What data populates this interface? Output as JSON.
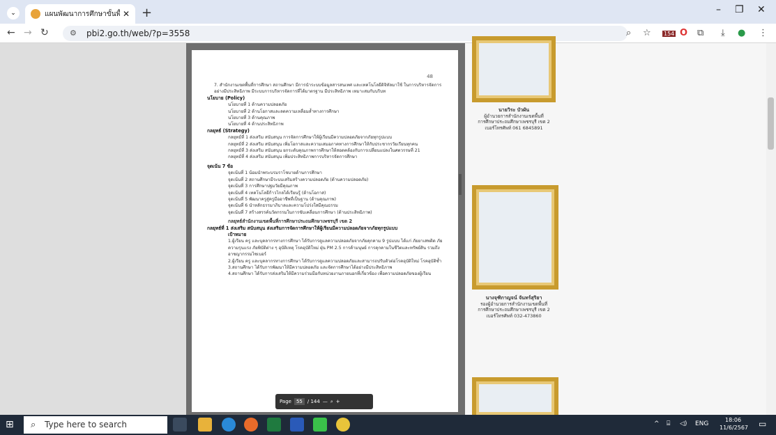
{
  "tab": {
    "title": "แผนพัฒนาการศึกษาขั้นพื้นฐาน ระยะ"
  },
  "address": {
    "url": "pbi2.go.th/web/?p=3558"
  },
  "document": {
    "page_number": "48",
    "intro_line": "7. สำนักงานเขตพื้นที่การศึกษา สถานศึกษา มีการนำระบบข้อมูลสารสนเทศ และเทคโนโลยีดิจิทัลมาใช้ ในการบริหารจัดการอย่างมีประสิทธิภาพ มีระบบการบริหารจัดการที่ได้มาตรฐาน มีประสิทธิภาพ เหมาะสมกับบริบท",
    "policy_head": "นโยบาย (Policy)",
    "policies": [
      "นโยบายที่ 1 ด้านความปลอดภัย",
      "นโยบายที่ 2 ด้านโอกาสและลดความเหลื่อมล้ำทางการศึกษา",
      "นโยบายที่ 3 ด้านคุณภาพ",
      "นโยบายที่ 4 ด้านประสิทธิภาพ"
    ],
    "strategy_head": "กลยุทธ์ (Strategy)",
    "strategies": [
      "กลยุทธ์ที่ 1 ส่งเสริม สนับสนุน การจัดการศึกษาให้ผู้เรียนมีความปลอดภัยจากภัยทุกรูปแบบ",
      "กลยุทธ์ที่ 2 ส่งเสริม สนับสนุน เพิ่มโอกาสและความเสมอภาคทางการศึกษาให้กับประชากรวัยเรียนทุกคน",
      "กลยุทธ์ที่ 3 ส่งเสริม สนับสนุน ยกระดับคุณภาพการศึกษาให้สอดคล้องกับการเปลี่ยนแปลงในศตวรรษที่ 21",
      "กลยุทธ์ที่ 4 ส่งเสริม สนับสนุน เพิ่มประสิทธิภาพการบริหารจัดการศึกษา"
    ],
    "focus_head": "จุดเน้น 7 ข้อ",
    "focus": [
      "จุดเน้นที่ 1 น้อมนำพระบรมราโชบายด้านการศึกษา",
      "จุดเน้นที่ 2 สถานศึกษามีระบบเสริมสร้างความปลอดภัย (ด้านความปลอดภัย)",
      "จุดเน้นที่ 3 การศึกษาปฐมวัยมีคุณภาพ",
      "จุดเน้นที่ 4 เทคโนโลยีก้าวไกลได้เรียนรู้ (ด้านโอกาส)",
      "จุดเน้นที่ 5 พัฒนาครูสู่ครูมืออาชีพที่เป็นฐาน (ด้านคุณภาพ)",
      "จุดเน้นที่ 6 นำหลักธรรมาภิบาลและความโปร่งใสมีคุณธรรม",
      "จุดเน้นที่ 7 สร้างสรรค์นวัตกรรมในการขับเคลื่อนการศึกษา (ด้านประสิทธิภาพ)"
    ],
    "section_title": "กลยุทธ์สำนักงานเขตพื้นที่การศึกษาประถมศึกษาเพชรบุรี เขต 2",
    "strategy1_title": "กลยุทธ์ที่ 1 ส่งเสริม สนับสนุน ส่งเสริมการจัดการศึกษาให้ผู้เรียนมีความปลอดภัยจากภัยทุกรูปแบบ",
    "goal_head": "เป้าหมาย",
    "goals": [
      "1.ผู้เรียน ครู และบุคลากรทางการศึกษา ได้รับการดูแลความปลอดภัยจากภัยคุกคาม 9 รูปแบบ ได้แก่ ภัยยาเสพติด ภัยความรุนแรง ภัยพิบัติต่าง ๆ อุบัติเหตุ โรคอุบัติใหม่ ฝุ่น PM 2.5 การค้ามนุษย์ การคุกคามในชีวิตและทรัพย์สิน รวมถึงอาชญากรรมไซเบอร์",
      "2.ผู้เรียน ครู และบุคลากรทางการศึกษา ได้รับการดูแลความปลอดภัยและสามารถปรับตัวต่อโรคอุบัติใหม่ โรคอุบัติซ้ำ",
      "3.สถานศึกษา ได้รับการพัฒนาให้มีความปลอดภัย และจัดการศึกษาได้อย่างมีประสิทธิภาพ",
      "4.สถานศึกษา ได้รับการส่งเสริมให้มีความร่วมมือกับหน่วยงานภายนอกที่เกี่ยวข้อง เพื่อความปลอดภัยของผู้เรียน"
    ]
  },
  "pager": {
    "label": "Page",
    "current": "55",
    "total": "/ 144"
  },
  "people": [
    {
      "name": "นายวิระ บัวผัน",
      "lines": [
        "ผู้อำนวยการสำนักงานเขตพื้นที่",
        "การศึกษาประถมศึกษาเพชรบุรี เขต 2",
        "เบอร์โทรศัพท์ 061 6845891"
      ]
    },
    {
      "name": "นางจุฑิกาญจน์ จันทร์สุริยา",
      "lines": [
        "รองผู้อำนวยการสำนักงานเขตพื้นที่",
        "การศึกษาประถมศึกษาเพชรบุรี เขต 2",
        "เบอร์โทรศัพท์ 032-473860"
      ]
    }
  ],
  "taskbar": {
    "search": "Type here to search",
    "lang": "ENG",
    "time": "18:06",
    "date": "11/6/2567",
    "badge": "154"
  }
}
